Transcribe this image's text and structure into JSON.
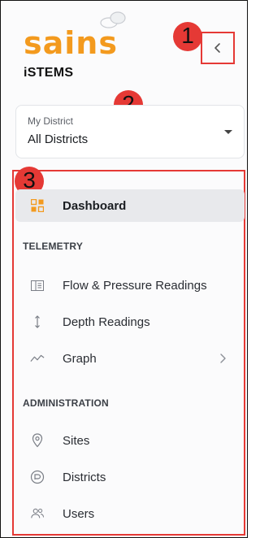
{
  "brand": {
    "logo_text": "sains",
    "app_name": "iSTEMS",
    "logo_color": "#f39a1e"
  },
  "header": {
    "collapse_icon": "chevron-left-icon"
  },
  "callouts": [
    "1",
    "2",
    "3"
  ],
  "district_select": {
    "label": "My District",
    "value": "All Districts"
  },
  "nav": {
    "dashboard": {
      "label": "Dashboard",
      "icon": "dashboard-grid-icon",
      "active": true
    },
    "telemetry_heading": "TELEMETRY",
    "telemetry_items": [
      {
        "label": "Flow & Pressure Readings",
        "icon": "book-open-icon"
      },
      {
        "label": "Depth Readings",
        "icon": "vertical-arrows-icon"
      },
      {
        "label": "Graph",
        "icon": "line-graph-icon",
        "has_submenu": true
      }
    ],
    "administration_heading": "ADMINISTRATION",
    "administration_items": [
      {
        "label": "Sites",
        "icon": "map-pin-icon"
      },
      {
        "label": "Districts",
        "icon": "district-badge-icon"
      },
      {
        "label": "Users",
        "icon": "users-icon"
      }
    ]
  },
  "colors": {
    "annotation_red": "#e53935",
    "active_bg": "#e8e9ec",
    "accent_orange": "#f39a1e"
  }
}
